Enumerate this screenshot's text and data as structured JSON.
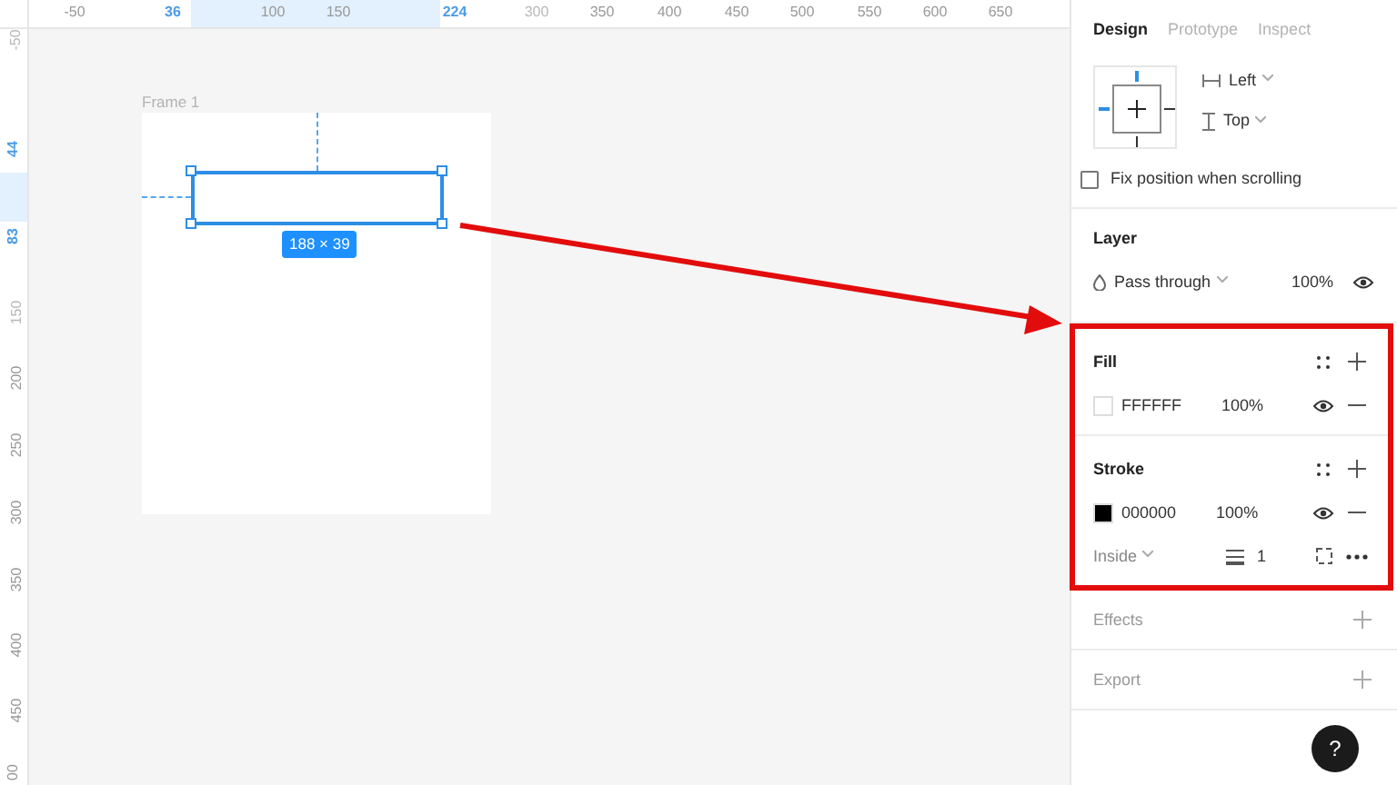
{
  "rulers": {
    "horizontal": [
      {
        "label": "-50",
        "kind": "tick"
      },
      {
        "label": "36",
        "kind": "bound"
      },
      {
        "label": "100",
        "kind": "tick"
      },
      {
        "label": "150",
        "kind": "tick"
      },
      {
        "label": "224",
        "kind": "bound"
      },
      {
        "label": "300",
        "kind": "faint"
      },
      {
        "label": "350",
        "kind": "tick"
      },
      {
        "label": "400",
        "kind": "tick"
      },
      {
        "label": "450",
        "kind": "tick"
      },
      {
        "label": "500",
        "kind": "tick"
      },
      {
        "label": "550",
        "kind": "tick"
      },
      {
        "label": "600",
        "kind": "tick"
      },
      {
        "label": "650",
        "kind": "tick"
      }
    ],
    "vertical": [
      {
        "label": "-50",
        "kind": "faint"
      },
      {
        "label": "44",
        "kind": "bound"
      },
      {
        "label": "83",
        "kind": "bound"
      },
      {
        "label": "150",
        "kind": "faint"
      },
      {
        "label": "200",
        "kind": "tick"
      },
      {
        "label": "250",
        "kind": "tick"
      },
      {
        "label": "300",
        "kind": "tick"
      },
      {
        "label": "350",
        "kind": "tick"
      },
      {
        "label": "400",
        "kind": "tick"
      },
      {
        "label": "450",
        "kind": "tick"
      },
      {
        "label": "00",
        "kind": "tick"
      }
    ]
  },
  "canvas": {
    "frame_label": "Frame 1",
    "dimension_badge": "188 × 39"
  },
  "panel": {
    "tabs": [
      {
        "label": "Design",
        "selected": true
      },
      {
        "label": "Prototype",
        "selected": false
      },
      {
        "label": "Inspect",
        "selected": false
      }
    ],
    "constraints": {
      "horizontal": "Left",
      "vertical": "Top"
    },
    "fix_position": {
      "label": "Fix position when scrolling",
      "checked": false
    },
    "layer": {
      "title": "Layer",
      "blend": "Pass through",
      "opacity": "100%"
    },
    "fill": {
      "title": "Fill",
      "items": [
        {
          "color": "#ffffff",
          "hex": "FFFFFF",
          "opacity": "100%"
        }
      ]
    },
    "stroke": {
      "title": "Stroke",
      "items": [
        {
          "color": "#000000",
          "hex": "000000",
          "opacity": "100%"
        }
      ],
      "position": "Inside",
      "weight": "1"
    },
    "sections": [
      {
        "title": "Effects"
      },
      {
        "title": "Export"
      }
    ],
    "help": "?"
  }
}
